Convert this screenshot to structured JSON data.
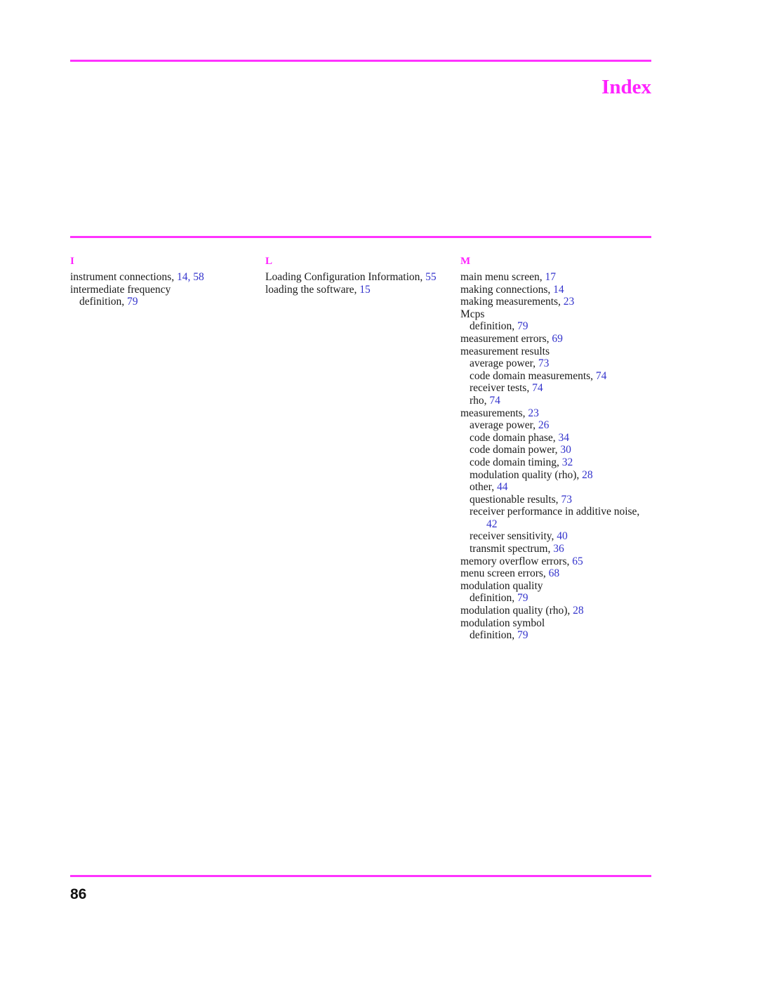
{
  "header": {
    "title": "Index",
    "rule_color": "#ff33ff"
  },
  "footer": {
    "page_number": "86"
  },
  "colors": {
    "accent_magenta": "#ff33ff",
    "page_number_blue": "#3333cc",
    "body_text": "#1a1a1a"
  },
  "columns": [
    {
      "letter": "I",
      "entries": [
        {
          "level": 0,
          "text": "instrument connections, ",
          "pages": "14, 58"
        },
        {
          "level": 0,
          "text": "intermediate frequency",
          "pages": ""
        },
        {
          "level": 1,
          "text": "definition, ",
          "pages": "79"
        }
      ]
    },
    {
      "letter": "L",
      "entries": [
        {
          "level": 0,
          "text": "Loading Configuration Information, ",
          "pages": "55"
        },
        {
          "level": 0,
          "text": "loading the software, ",
          "pages": "15"
        }
      ]
    },
    {
      "letter": "M",
      "entries": [
        {
          "level": 0,
          "text": "main menu screen, ",
          "pages": "17"
        },
        {
          "level": 0,
          "text": "making connections, ",
          "pages": "14"
        },
        {
          "level": 0,
          "text": "making measurements, ",
          "pages": "23"
        },
        {
          "level": 0,
          "text": "Mcps",
          "pages": ""
        },
        {
          "level": 1,
          "text": "definition, ",
          "pages": "79"
        },
        {
          "level": 0,
          "text": "measurement errors, ",
          "pages": "69"
        },
        {
          "level": 0,
          "text": "measurement results",
          "pages": ""
        },
        {
          "level": 1,
          "text": "average power, ",
          "pages": "73"
        },
        {
          "level": 1,
          "text": "code domain measurements, ",
          "pages": "74"
        },
        {
          "level": 1,
          "text": "receiver tests, ",
          "pages": "74"
        },
        {
          "level": 1,
          "text": "rho, ",
          "pages": "74"
        },
        {
          "level": 0,
          "text": "measurements, ",
          "pages": "23"
        },
        {
          "level": 1,
          "text": "average power, ",
          "pages": "26"
        },
        {
          "level": 1,
          "text": "code domain phase, ",
          "pages": "34"
        },
        {
          "level": 1,
          "text": "code domain power, ",
          "pages": "30"
        },
        {
          "level": 1,
          "text": "code domain timing, ",
          "pages": "32"
        },
        {
          "level": 1,
          "text": "modulation quality (rho), ",
          "pages": "28"
        },
        {
          "level": 1,
          "text": "other, ",
          "pages": "44"
        },
        {
          "level": 1,
          "text": "questionable results, ",
          "pages": "73"
        },
        {
          "level": 1,
          "text": "receiver performance in additive noise,",
          "pages": "",
          "wraps": true
        },
        {
          "level": 2,
          "text": "",
          "pages": "42"
        },
        {
          "level": 1,
          "text": "receiver sensitivity, ",
          "pages": "40"
        },
        {
          "level": 1,
          "text": "transmit spectrum, ",
          "pages": "36"
        },
        {
          "level": 0,
          "text": "memory overflow errors, ",
          "pages": "65"
        },
        {
          "level": 0,
          "text": "menu screen errors, ",
          "pages": "68"
        },
        {
          "level": 0,
          "text": "modulation quality",
          "pages": ""
        },
        {
          "level": 1,
          "text": "definition, ",
          "pages": "79"
        },
        {
          "level": 0,
          "text": "modulation quality (rho), ",
          "pages": "28"
        },
        {
          "level": 0,
          "text": "modulation symbol",
          "pages": ""
        },
        {
          "level": 1,
          "text": "definition, ",
          "pages": "79"
        }
      ]
    }
  ]
}
